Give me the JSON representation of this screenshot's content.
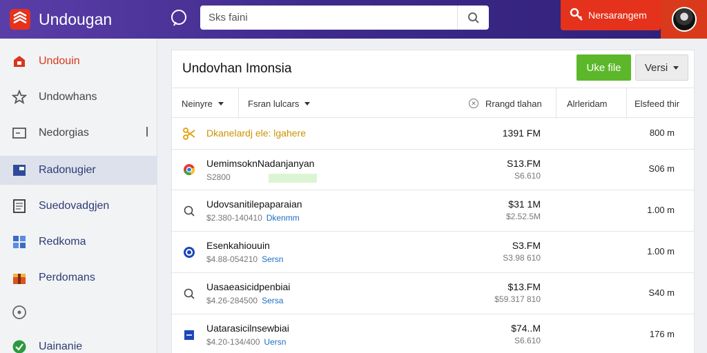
{
  "app": {
    "title": "Undougan",
    "brand_color": "#4a33a0",
    "accent": "#e5321c"
  },
  "search": {
    "value": "Sks faini",
    "icon": "search-icon"
  },
  "top_button": {
    "label": "Nersarangem",
    "icon": "key-icon"
  },
  "sidebar": {
    "items": [
      {
        "label": "Undouin",
        "icon": "home-icon",
        "color": "#d8371c"
      },
      {
        "label": "Undowhans",
        "icon": "star-icon",
        "color": "#444444"
      },
      {
        "label": "Nedorgias",
        "icon": "window-icon",
        "color": "#444444"
      },
      {
        "label": "Radonugier",
        "icon": "folder-icon",
        "color": "#2e3b74"
      },
      {
        "label": "Suedovadgjen",
        "icon": "document-icon",
        "color": "#2e3b74"
      },
      {
        "label": "Redkoma",
        "icon": "grid-icon",
        "color": "#2e3b74"
      },
      {
        "label": "Perdomans",
        "icon": "gift-icon",
        "color": "#2e3b74"
      },
      {
        "label": "",
        "icon": "circle-icon",
        "color": "#444444"
      },
      {
        "label": "Uainanie",
        "icon": "check-circle-icon",
        "color": "#2e3b74"
      }
    ]
  },
  "panel": {
    "title": "Undovhan Imonsia",
    "primary_button": "Uke file",
    "secondary_button": "Versi",
    "headers": {
      "col1": "Neinyre",
      "col2": "Fsran lulcars",
      "col3": "Rrangd tlahan",
      "col4": "Alrleridam",
      "col5": "Elsfeed thir"
    },
    "rows": [
      {
        "icon": "scissors-icon",
        "name": "Dkanelardj ele: lgahere",
        "sub": "",
        "tag": "",
        "amt": "1391 FM",
        "amt2": "",
        "last": "800 m"
      },
      {
        "icon": "chrome-icon",
        "name": "UemimsoknNadanjanyan",
        "sub": "S2800",
        "tag": "",
        "amt": "S13.FM",
        "amt2": "S6.610",
        "last": "S06 m"
      },
      {
        "icon": "search-icon",
        "name": "Udovsanitilepaparaian",
        "sub": "$2.380-140410",
        "tag": "Dkenmm",
        "amt": "$31 1M",
        "amt2": "$2.52.5M",
        "last": "1.00 m"
      },
      {
        "icon": "ring-icon",
        "name": "Esenkahiouuin",
        "sub": "$4.88-054210",
        "tag": "Sersn",
        "amt": "S3.FM",
        "amt2": "S3.98 610",
        "last": "1.00 m"
      },
      {
        "icon": "search-icon",
        "name": "Uasaeasicidpenbiai",
        "sub": "$4.26-284500",
        "tag": "Sersa",
        "amt": "$13.FM",
        "amt2": "$59.317 810",
        "last": "S40 m"
      },
      {
        "icon": "square-icon",
        "name": "Uatarasicilnsewbiai",
        "sub": "$4.20-134/400",
        "tag": "Uersn",
        "amt": "$74..M",
        "amt2": "S6.610",
        "last": "176 m"
      }
    ]
  }
}
